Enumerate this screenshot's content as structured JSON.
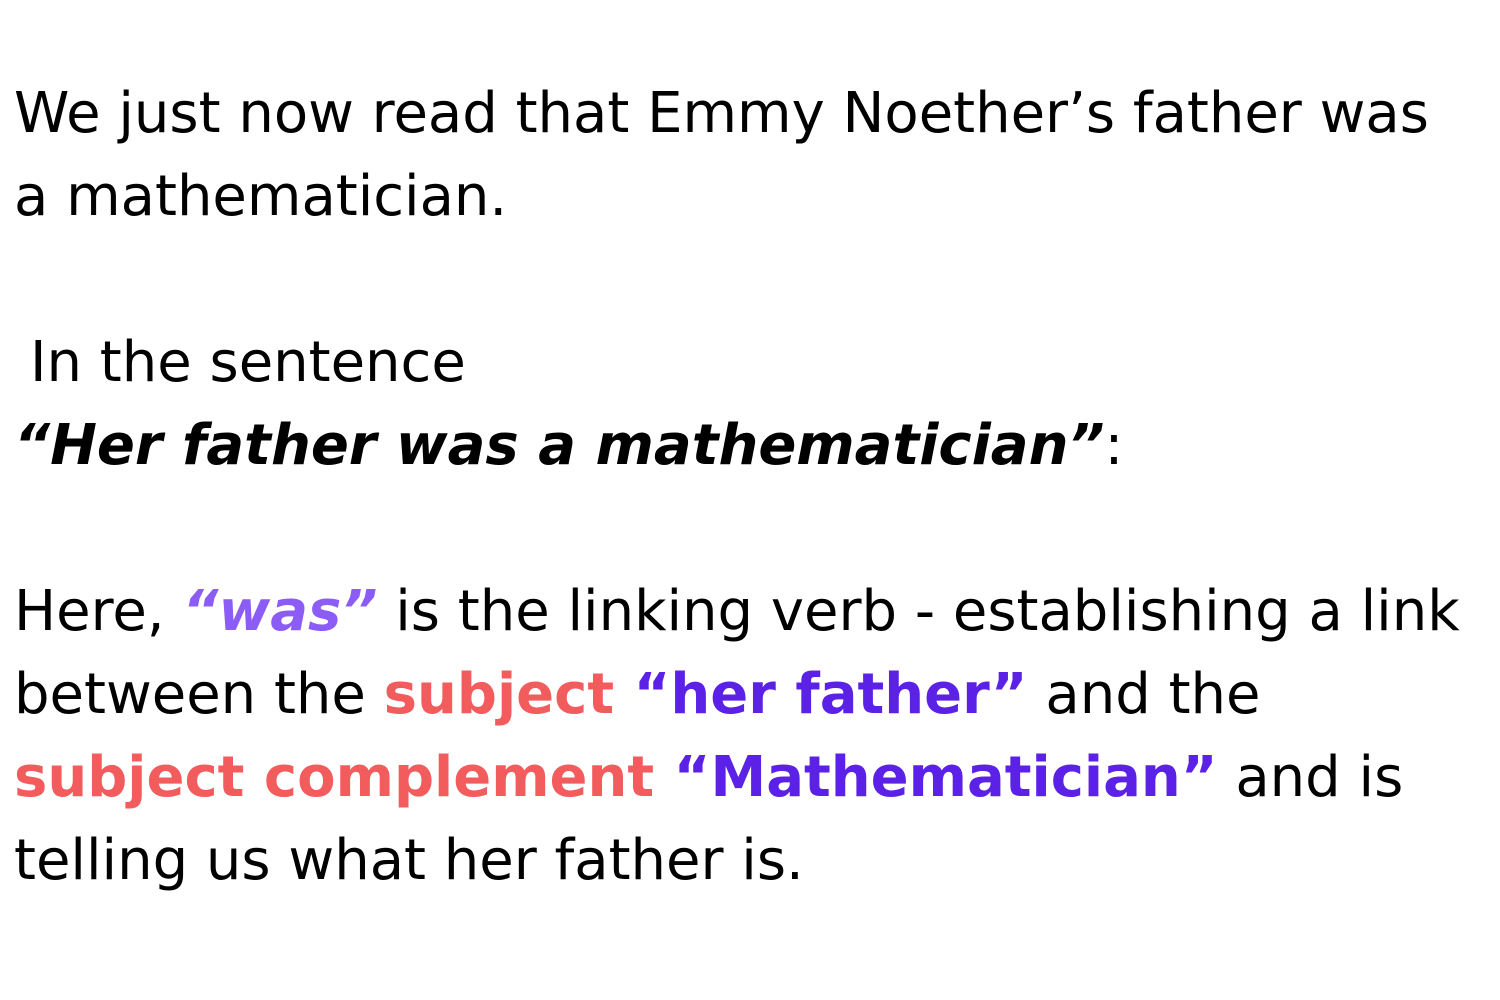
{
  "colors": {
    "text": "#000000",
    "verb": "#8b5cf6",
    "label": "#f25c5c",
    "term": "#5b21e6"
  },
  "paragraph1": {
    "text": "We just now read that Emmy Noether’s father was a mathematician."
  },
  "paragraph2": {
    "intro": "In the sentence",
    "quote": "“Her father was a mathematician”",
    "colon": ":"
  },
  "paragraph3": {
    "part1": "Here, ",
    "verb": "“was”",
    "part2": " is the linking verb - establishing a link between the ",
    "subject_label": "subject",
    "subject_term": " “her father”",
    "part3": " and the ",
    "complement_label": "subject complement",
    "complement_term": " “Mathematician”",
    "part4": " and is telling us what her father is."
  }
}
